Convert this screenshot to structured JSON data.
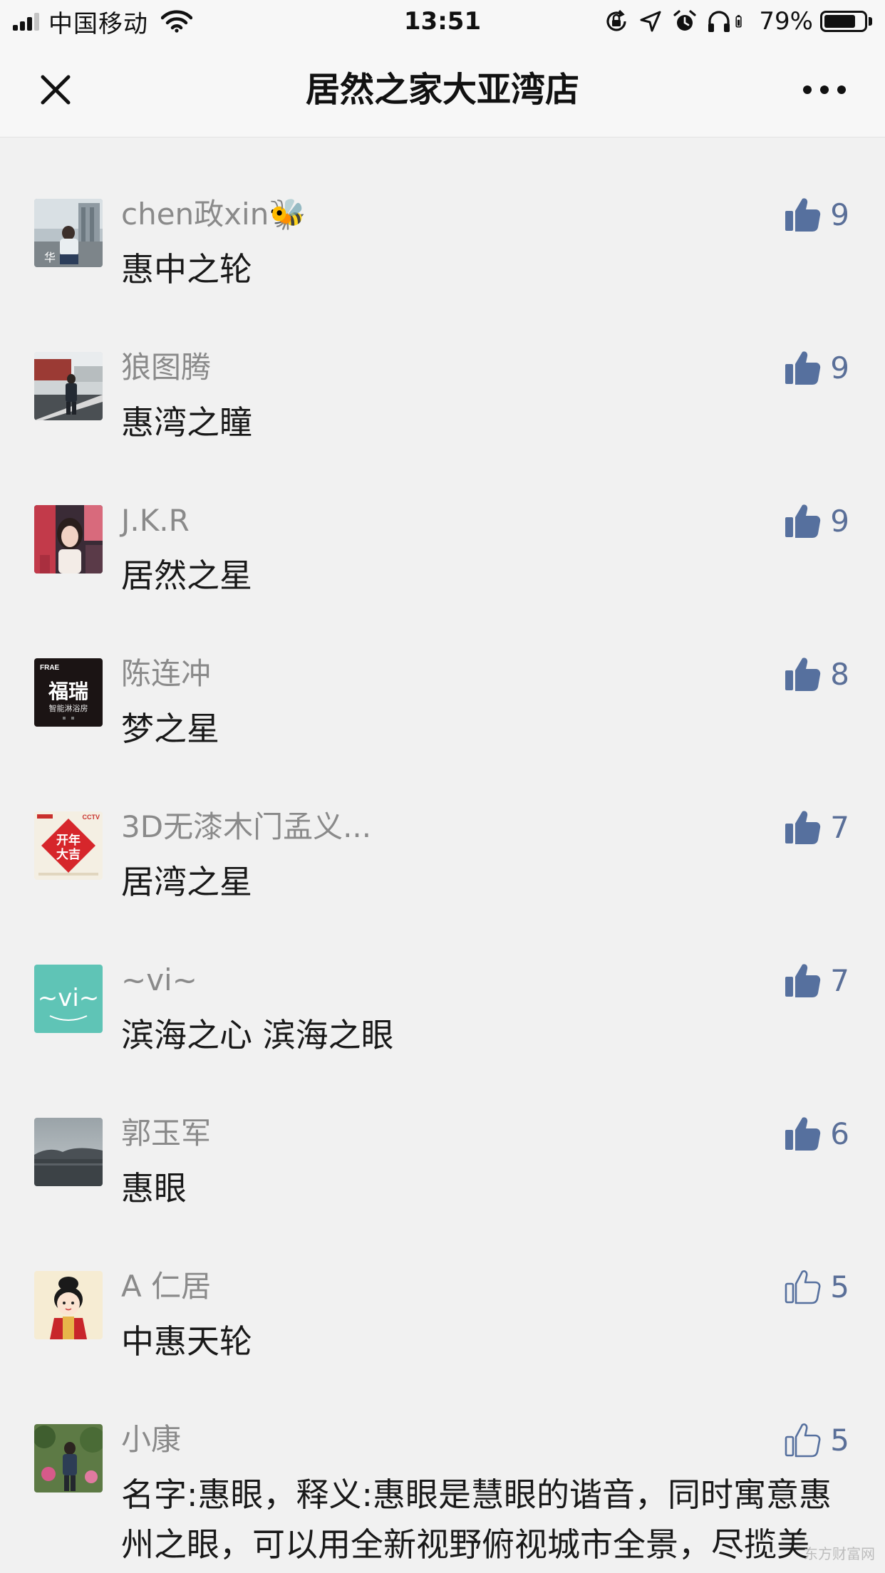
{
  "status_bar": {
    "carrier": "中国移动",
    "time": "13:51",
    "battery_percent": "79%",
    "battery_level": 0.79,
    "signal_bars": 3
  },
  "nav": {
    "title": "居然之家大亚湾店",
    "close_icon": "close-icon",
    "more_icon": "more-icon"
  },
  "colors": {
    "like_filled": "#56709e",
    "like_count": "#5a6f98",
    "name": "#8a8a8a",
    "background": "#f1f1f1"
  },
  "comments": [
    {
      "name": "chen政xin🐝",
      "text": "惠中之轮",
      "likes": "9",
      "liked": true,
      "avatar": "photo-person-building"
    },
    {
      "name": "狼图腾",
      "text": "惠湾之瞳",
      "likes": "9",
      "liked": true,
      "avatar": "photo-street"
    },
    {
      "name": "J.K.R",
      "text": "居然之星",
      "likes": "9",
      "liked": true,
      "avatar": "photo-girl"
    },
    {
      "name": "陈连冲",
      "text": "梦之星",
      "likes": "8",
      "liked": true,
      "avatar": "logo-furui"
    },
    {
      "name": "3D无漆木门孟义...",
      "text": "居湾之星",
      "likes": "7",
      "liked": true,
      "avatar": "logo-new-year"
    },
    {
      "name": "~vi~",
      "text": "滨海之心 滨海之眼",
      "likes": "7",
      "liked": true,
      "avatar": "logo-vi"
    },
    {
      "name": "郭玉军",
      "text": "惠眼",
      "likes": "6",
      "liked": true,
      "avatar": "photo-lake"
    },
    {
      "name": "A 仁居",
      "text": "中惠天轮",
      "likes": "5",
      "liked": false,
      "avatar": "cartoon-character"
    },
    {
      "name": "小康",
      "text": "名字:惠眼，释义:惠眼是慧眼的谐音，同时寓意惠州之眼，可以用全新视野俯视城市全景，尽揽美景，便于传播，唐今山",
      "likes": "5",
      "liked": false,
      "avatar": "photo-man-garden"
    }
  ],
  "avatar_texts": {
    "chen": "华",
    "furui_brand": "FRAE",
    "furui_main": "福瑞",
    "furui_sub": "智能淋浴房",
    "ny_brand": "CCTV",
    "ny_main_1": "开年",
    "ny_main_2": "大吉",
    "vi": "~vi~"
  },
  "watermark": "东方财富网"
}
